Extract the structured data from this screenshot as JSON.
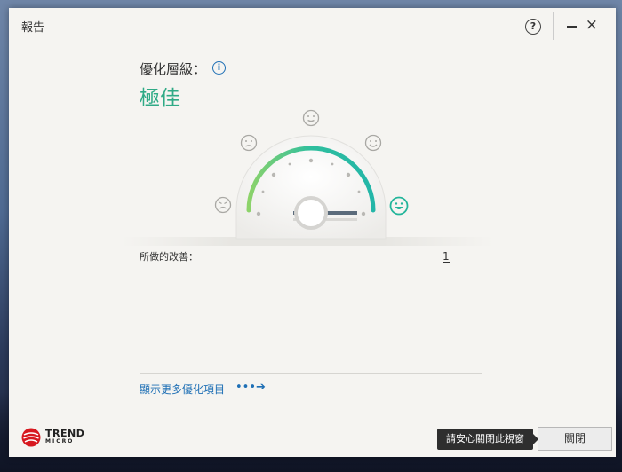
{
  "window": {
    "title": "報告",
    "help_label": "?",
    "close_label": "×"
  },
  "optimization": {
    "level_label": "優化層級：",
    "info_label": "i",
    "level_value": "極佳"
  },
  "gauge": {
    "faces": [
      "very-unhappy-face-icon",
      "unhappy-face-icon",
      "neutral-face-icon",
      "content-face-icon",
      "happy-face-icon"
    ],
    "selected_face": "happy-face-icon",
    "arc_gradient": [
      "#8dd36a",
      "#2fbf9e",
      "#23b6a8"
    ]
  },
  "improvements": {
    "label": "所做的改善：",
    "count": "1"
  },
  "links": {
    "more": "顯示更多優化項目",
    "more_arrow": "•••➔"
  },
  "logo": {
    "line1": "TREND",
    "line2": "MICRO"
  },
  "footer": {
    "tooltip": "請安心關閉此視窗",
    "close_button": "關閉"
  },
  "colors": {
    "accent_green": "#2faa86",
    "link_blue": "#1e6fb5",
    "brand_red": "#d71920"
  }
}
